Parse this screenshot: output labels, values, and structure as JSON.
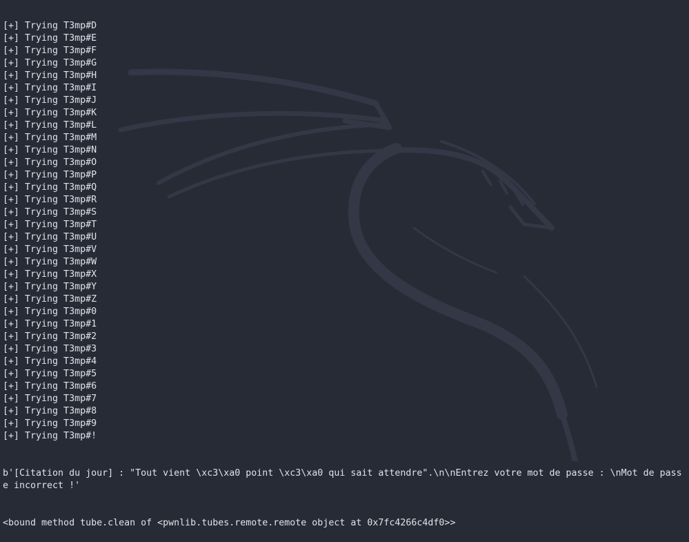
{
  "terminal": {
    "lines": [
      "[+] Trying T3mp#D",
      "[+] Trying T3mp#E",
      "[+] Trying T3mp#F",
      "[+] Trying T3mp#G",
      "[+] Trying T3mp#H",
      "[+] Trying T3mp#I",
      "[+] Trying T3mp#J",
      "[+] Trying T3mp#K",
      "[+] Trying T3mp#L",
      "[+] Trying T3mp#M",
      "[+] Trying T3mp#N",
      "[+] Trying T3mp#O",
      "[+] Trying T3mp#P",
      "[+] Trying T3mp#Q",
      "[+] Trying T3mp#R",
      "[+] Trying T3mp#S",
      "[+] Trying T3mp#T",
      "[+] Trying T3mp#U",
      "[+] Trying T3mp#V",
      "[+] Trying T3mp#W",
      "[+] Trying T3mp#X",
      "[+] Trying T3mp#Y",
      "[+] Trying T3mp#Z",
      "[+] Trying T3mp#0",
      "[+] Trying T3mp#1",
      "[+] Trying T3mp#2",
      "[+] Trying T3mp#3",
      "[+] Trying T3mp#4",
      "[+] Trying T3mp#5",
      "[+] Trying T3mp#6",
      "[+] Trying T3mp#7",
      "[+] Trying T3mp#8",
      "[+] Trying T3mp#9",
      "[+] Trying T3mp#!"
    ],
    "response": "b'[Citation du jour] : \"Tout vient \\xc3\\xa0 point \\xc3\\xa0 qui sait attendre\".\\n\\nEntrez votre mot de passe : \\nMot de passe incorrect !'",
    "bound_method": "<bound method tube.clean of <pwnlib.tubes.remote.remote object at 0x7fc4266c4df0>>"
  },
  "colors": {
    "background": "#262b35",
    "text": "#dfe3ea",
    "watermark": "#323845"
  },
  "watermark_icon": "kali-dragon-icon"
}
